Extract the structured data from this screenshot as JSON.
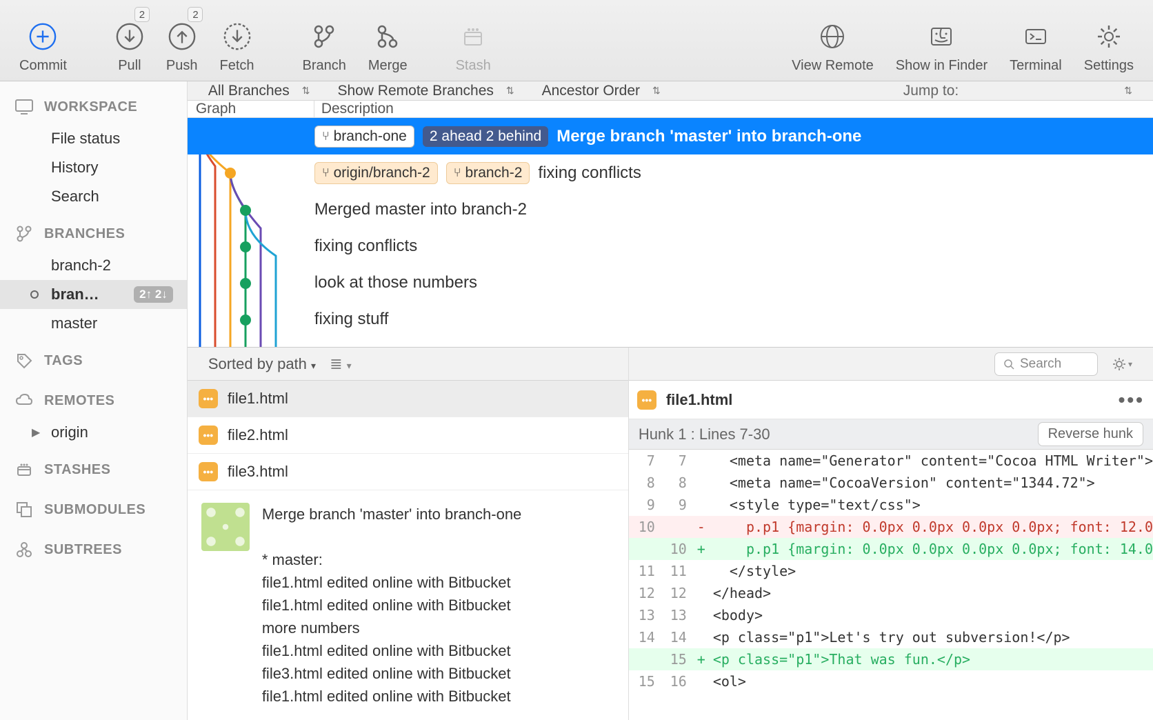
{
  "toolbar": {
    "commit": "Commit",
    "pull": "Pull",
    "pull_badge": "2",
    "push": "Push",
    "push_badge": "2",
    "fetch": "Fetch",
    "branch": "Branch",
    "merge": "Merge",
    "stash": "Stash",
    "view_remote": "View Remote",
    "show_in_finder": "Show in Finder",
    "terminal": "Terminal",
    "settings": "Settings"
  },
  "sidebar": {
    "workspace": {
      "title": "WORKSPACE",
      "items": [
        "File status",
        "History",
        "Search"
      ]
    },
    "branches": {
      "title": "BRANCHES",
      "items": [
        {
          "name": "branch-2",
          "active": false
        },
        {
          "name": "bran…",
          "active": true,
          "status": "2↑ 2↓"
        },
        {
          "name": "master",
          "active": false
        }
      ]
    },
    "tags": {
      "title": "TAGS"
    },
    "remotes": {
      "title": "REMOTES",
      "items": [
        "origin"
      ]
    },
    "stashes": {
      "title": "STASHES"
    },
    "submodules": {
      "title": "SUBMODULES"
    },
    "subtrees": {
      "title": "SUBTREES"
    }
  },
  "filters": {
    "branches": "All Branches",
    "remote": "Show Remote Branches",
    "order": "Ancestor Order",
    "jump": "Jump to:"
  },
  "columns": {
    "graph": "Graph",
    "description": "Description"
  },
  "commits": [
    {
      "branch_tag": "branch-one",
      "branch_status": "2 ahead 2 behind",
      "message": "Merge branch 'master' into branch-one",
      "selected": true
    },
    {
      "remote_tag": "origin/branch-2",
      "local_tag": "branch-2",
      "message": "fixing conflicts"
    },
    {
      "message": "Merged master into branch-2"
    },
    {
      "message": "fixing conflicts"
    },
    {
      "message": "look at those numbers"
    },
    {
      "message": "fixing stuff"
    }
  ],
  "file_sort": "Sorted by path",
  "files": [
    "file1.html",
    "file2.html",
    "file3.html"
  ],
  "search_placeholder": "Search",
  "selected_file": "file1.html",
  "commit_detail": {
    "title": "Merge branch 'master' into branch-one",
    "lines": [
      "* master:",
      "file1.html edited online with Bitbucket",
      "file1.html edited online with Bitbucket",
      "more numbers",
      "file1.html edited online with Bitbucket",
      "file3.html edited online with Bitbucket",
      "file1.html edited online with Bitbucket"
    ]
  },
  "diff": {
    "file": "file1.html",
    "hunk": "Hunk 1 : Lines 7-30",
    "reverse": "Reverse hunk",
    "lines": [
      {
        "l": "7",
        "r": "7",
        "t": "ctx",
        "code": "  <meta name=\"Generator\" content=\"Cocoa HTML Writer\">"
      },
      {
        "l": "8",
        "r": "8",
        "t": "ctx",
        "code": "  <meta name=\"CocoaVersion\" content=\"1344.72\">"
      },
      {
        "l": "9",
        "r": "9",
        "t": "ctx",
        "code": "  <style type=\"text/css\">"
      },
      {
        "l": "10",
        "r": "",
        "t": "del",
        "code": "    p.p1 {margin: 0.0px 0.0px 0.0px 0.0px; font: 12.0"
      },
      {
        "l": "",
        "r": "10",
        "t": "add",
        "code": "    p.p1 {margin: 0.0px 0.0px 0.0px 0.0px; font: 14.0"
      },
      {
        "l": "11",
        "r": "11",
        "t": "ctx",
        "code": "  </style>"
      },
      {
        "l": "12",
        "r": "12",
        "t": "ctx",
        "code": "</head>"
      },
      {
        "l": "13",
        "r": "13",
        "t": "ctx",
        "code": "<body>"
      },
      {
        "l": "14",
        "r": "14",
        "t": "ctx",
        "code": "<p class=\"p1\">Let's try out subversion!</p>"
      },
      {
        "l": "",
        "r": "15",
        "t": "add",
        "code": "<p class=\"p1\">That was fun.</p>"
      },
      {
        "l": "15",
        "r": "16",
        "t": "ctx",
        "code": "<ol>"
      }
    ]
  }
}
